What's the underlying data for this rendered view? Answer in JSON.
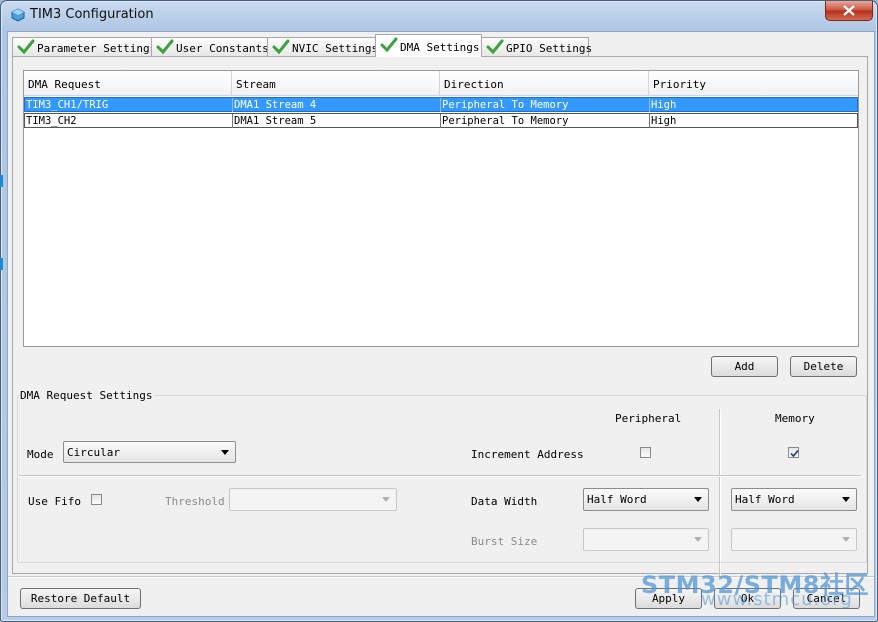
{
  "window": {
    "title": "TIM3 Configuration"
  },
  "tabs": [
    {
      "label": "Parameter Settings",
      "active": false
    },
    {
      "label": "User Constants",
      "active": false
    },
    {
      "label": "NVIC Settings",
      "active": false
    },
    {
      "label": "DMA Settings",
      "active": true
    },
    {
      "label": "GPIO Settings",
      "active": false
    }
  ],
  "dma_table": {
    "columns": [
      "DMA Request",
      "Stream",
      "Direction",
      "Priority"
    ],
    "rows": [
      {
        "request": "TIM3_CH1/TRIG",
        "stream": "DMA1 Stream 4",
        "direction": "Peripheral To Memory",
        "priority": "High",
        "selected": true
      },
      {
        "request": "TIM3_CH2",
        "stream": "DMA1 Stream 5",
        "direction": "Peripheral To Memory",
        "priority": "High",
        "selected": false
      }
    ]
  },
  "buttons": {
    "add": "Add",
    "delete": "Delete",
    "restore_default": "Restore Default",
    "apply": "Apply",
    "ok": "Ok",
    "cancel": "Cancel"
  },
  "request_settings": {
    "group_title": "DMA Request Settings",
    "peripheral_header": "Peripheral",
    "memory_header": "Memory",
    "mode_label": "Mode",
    "mode_value": "Circular",
    "increment_address_label": "Increment Address",
    "increment_peripheral": false,
    "increment_memory": true,
    "use_fifo_label": "Use Fifo",
    "use_fifo": false,
    "threshold_label": "Threshold",
    "threshold_value": "",
    "data_width_label": "Data Width",
    "data_width_peripheral": "Half Word",
    "data_width_memory": "Half Word",
    "burst_size_label": "Burst Size",
    "burst_size_peripheral": "",
    "burst_size_memory": ""
  },
  "watermark": {
    "line1": "STM32/STM8社区",
    "line2": "www.stmcu.org"
  },
  "colors": {
    "selection": "#3399ff",
    "check_green": "#3aa23a",
    "close_red": "#c8513c"
  }
}
